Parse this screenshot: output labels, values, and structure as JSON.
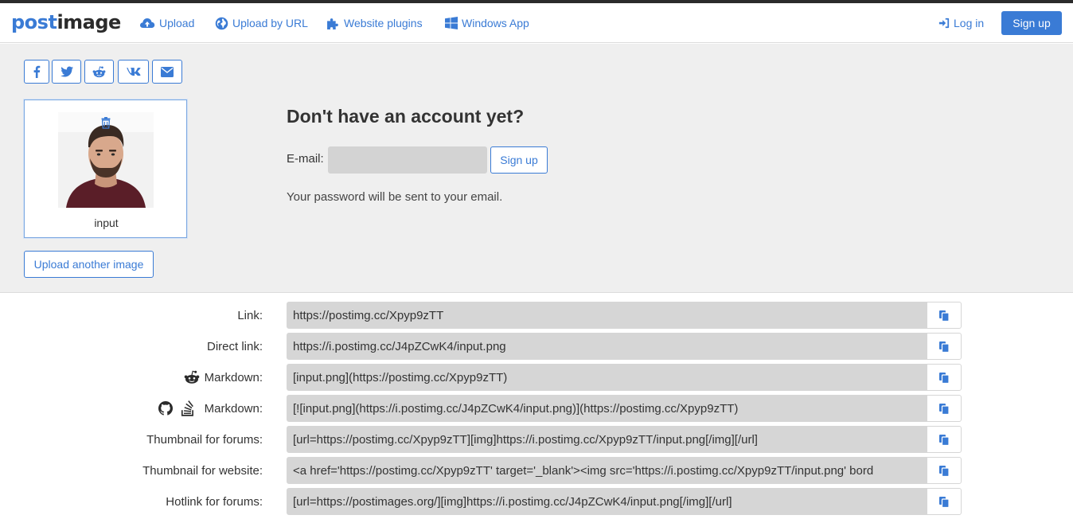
{
  "brand": {
    "logo_part1": "post",
    "logo_part2": "image"
  },
  "nav": {
    "upload": "Upload",
    "upload_by_url": "Upload by URL",
    "website_plugins": "Website plugins",
    "windows_app": "Windows App",
    "login": "Log in",
    "signup": "Sign up"
  },
  "share_buttons": [
    "facebook-icon",
    "twitter-icon",
    "reddit-icon",
    "vk-icon",
    "envelope-icon"
  ],
  "image_card": {
    "label": "input"
  },
  "upload_another": "Upload another image",
  "account": {
    "title": "Don't have an account yet?",
    "email_label": "E-mail:",
    "email_value": "",
    "signup": "Sign up",
    "note": "Your password will be sent to your email."
  },
  "links": [
    {
      "label": "Link:",
      "value": "https://postimg.cc/Xpyp9zTT"
    },
    {
      "label": "Direct link:",
      "value": "https://i.postimg.cc/J4pZCwK4/input.png"
    },
    {
      "label": "Markdown:",
      "value": "[input.png](https://postimg.cc/Xpyp9zTT)"
    },
    {
      "label": "Markdown:",
      "value": "[![input.png](https://i.postimg.cc/J4pZCwK4/input.png)](https://postimg.cc/Xpyp9zTT)"
    },
    {
      "label": "Thumbnail for forums:",
      "value": "[url=https://postimg.cc/Xpyp9zTT][img]https://i.postimg.cc/Xpyp9zTT/input.png[/img][/url]"
    },
    {
      "label": "Thumbnail for website:",
      "value": "<a href='https://postimg.cc/Xpyp9zTT' target='_blank'><img src='https://i.postimg.cc/Xpyp9zTT/input.png' bord"
    },
    {
      "label": "Hotlink for forums:",
      "value": "[url=https://postimages.org/][img]https://i.postimg.cc/J4pZCwK4/input.png[/img][/url]"
    }
  ],
  "colors": {
    "accent": "#3a7bd5",
    "panel": "#efefef",
    "field": "#d6d6d6"
  }
}
